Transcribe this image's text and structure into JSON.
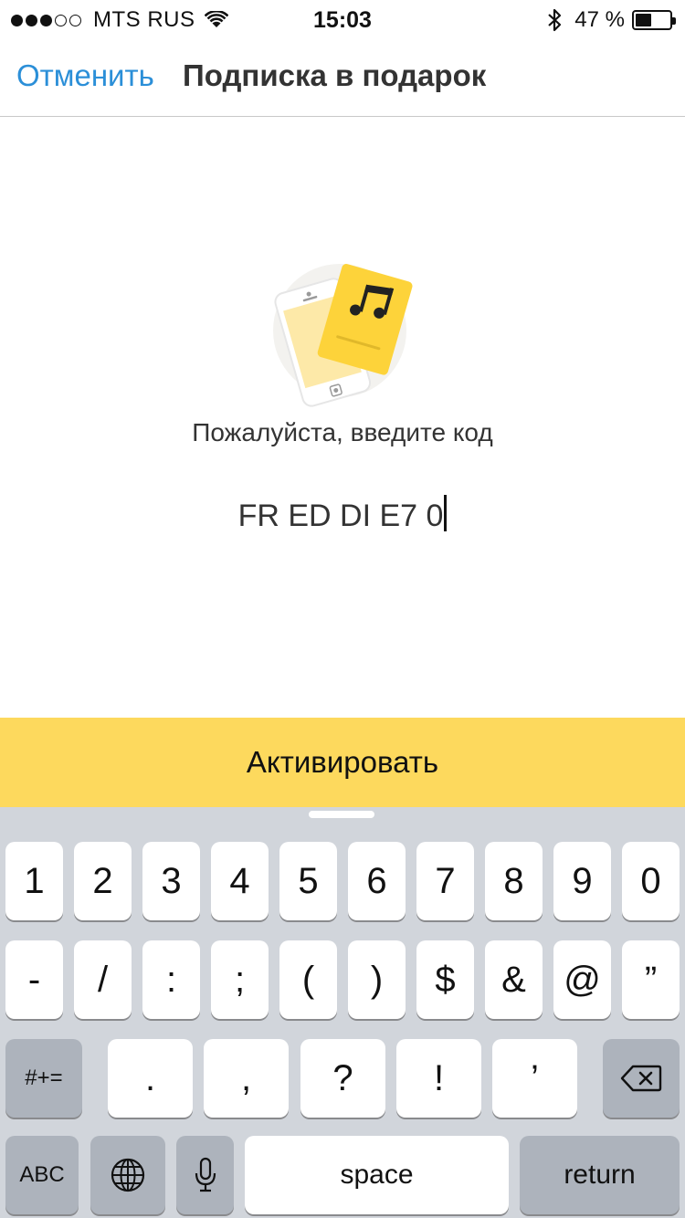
{
  "status_bar": {
    "signal_full": 3,
    "signal_empty": 2,
    "carrier": "MTS RUS",
    "time": "15:03",
    "battery_percent": "47 %",
    "battery_level": 0.47
  },
  "nav": {
    "cancel_label": "Отменить",
    "title": "Подписка в подарок"
  },
  "content": {
    "prompt": "Пожалуйста, введите код",
    "code_value": "FR ED DI E7 0"
  },
  "activate_label": "Активировать",
  "colors": {
    "accent_blue": "#2b8fd8",
    "button_yellow": "#fdd95d",
    "keyboard_bg": "#d1d5db"
  },
  "keyboard": {
    "row1": [
      "1",
      "2",
      "3",
      "4",
      "5",
      "6",
      "7",
      "8",
      "9",
      "0"
    ],
    "row2": [
      "-",
      "/",
      ":",
      ";",
      "(",
      ")",
      "$",
      "&",
      "@",
      "”"
    ],
    "row3": {
      "shift_label": "#+=",
      "keys": [
        ".",
        ",",
        "?",
        "!",
        "’"
      ],
      "delete_icon": "backspace-icon"
    },
    "row4": {
      "abc_label": "ABC",
      "globe_icon": "globe-icon",
      "mic_icon": "microphone-icon",
      "space_label": "space",
      "return_label": "return"
    }
  }
}
